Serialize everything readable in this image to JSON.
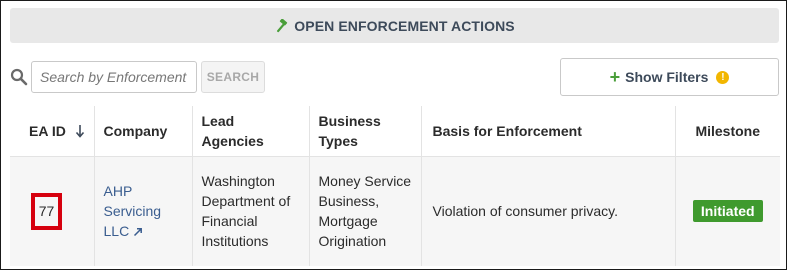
{
  "header": {
    "title": "OPEN ENFORCEMENT ACTIONS",
    "icon": "hammer-icon"
  },
  "search": {
    "placeholder": "Search by Enforcement Action ID",
    "value": "",
    "button_label": "SEARCH"
  },
  "filters": {
    "button_label": "Show Filters",
    "info_glyph": "!"
  },
  "table": {
    "columns": [
      {
        "label": "EA ID",
        "sort": "descending"
      },
      {
        "label": "Company"
      },
      {
        "label": "Lead Agencies"
      },
      {
        "label": "Business Types"
      },
      {
        "label": "Basis for Enforcement"
      },
      {
        "label": "Milestone"
      }
    ],
    "rows": [
      {
        "ea_id": "77",
        "company": "AHP Servicing LLC",
        "lead_agencies": "Washington Department of Financial Institutions",
        "business_types": "Money Service Business, Mortgage Origination",
        "basis": "Violation of consumer privacy.",
        "milestone": "Initiated"
      }
    ]
  },
  "colors": {
    "header_bg": "#e8e8e8",
    "header_text": "#3d4a5a",
    "accent_green": "#3f9a2e",
    "link_blue": "#3a5d8f",
    "highlight_red": "#d6000e",
    "info_yellow": "#f2b600"
  }
}
